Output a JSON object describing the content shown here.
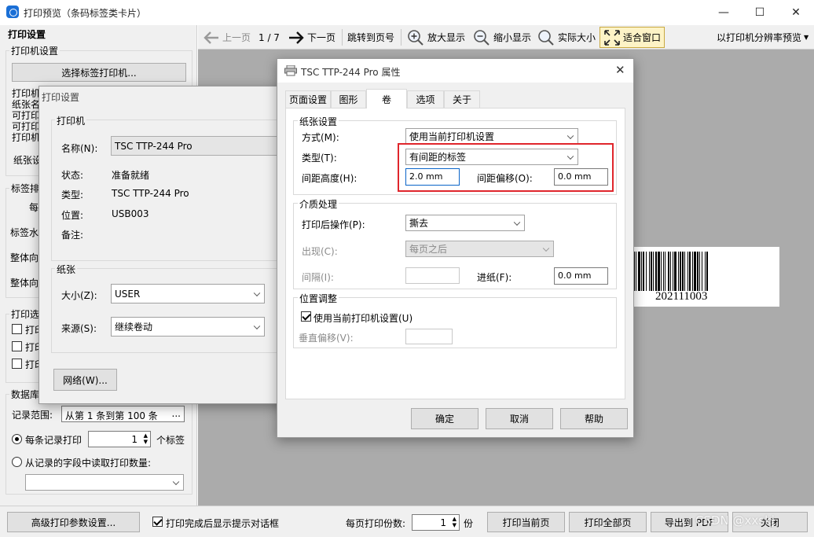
{
  "window": {
    "title": "打印预览（条码标签类卡片）",
    "minimize": "—",
    "maximize": "☐",
    "close": "✕"
  },
  "left_panel": {
    "header": "打印设置",
    "printer_group": {
      "title": "打印机设置",
      "select_button": "选择标签打印机...",
      "info_lines": [
        "打印机",
        "纸张名",
        "可打印",
        "可打印",
        "打印机"
      ],
      "paper_label": "纸张设"
    },
    "label_group": {
      "title": "标签排",
      "row1": "每",
      "watermark": "标签水",
      "orient1": "整体向",
      "orient2": "整体向"
    },
    "print_options": {
      "title": "打印选",
      "items": [
        "打印",
        "打印",
        "打印"
      ]
    },
    "database": {
      "title": "数据库",
      "range_label": "记录范围:",
      "range_value": "从第 1 条到第 100 条",
      "range_btn": "...",
      "per_record_label": "每条记录打印",
      "per_record_value": "1",
      "per_record_unit": "个标签",
      "from_field_label": "从记录的字段中读取打印数量:"
    }
  },
  "toolbar": {
    "prev": "上一页",
    "page": "1 / 7",
    "next": "下一页",
    "jump": "跳转到页号",
    "zoom_in": "放大显示",
    "zoom_out": "缩小显示",
    "actual": "实际大小",
    "fit": "适合窗口",
    "resolution": "以打印机分辨率预览"
  },
  "barcode": {
    "text": "202111003"
  },
  "bottom": {
    "advanced": "高级打印参数设置...",
    "show_dialog": "打印完成后显示提示对话框",
    "copies_label": "每页打印份数:",
    "copies_value": "1",
    "copies_unit": "份",
    "print_current": "打印当前页",
    "print_all": "打印全部页",
    "export_pdf": "导出到 PDF",
    "close": "关闭",
    "watermark": "CSDN @xxskj"
  },
  "print_settings_dialog": {
    "title": "打印设置",
    "printer_group": "打印机",
    "name_label": "名称(N):",
    "name_value": "TSC TTP-244 Pro",
    "status_label": "状态:",
    "status_value": "准备就绪",
    "type_label": "类型:",
    "type_value": "TSC TTP-244 Pro",
    "location_label": "位置:",
    "location_value": "USB003",
    "comment_label": "备注:",
    "paper_group": "纸张",
    "size_label": "大小(Z):",
    "size_value": "USER",
    "source_label": "来源(S):",
    "source_value": "继续卷动",
    "network_btn": "网络(W)..."
  },
  "properties_dialog": {
    "title": "TSC TTP-244 Pro 属性",
    "tabs": [
      "页面设置",
      "图形",
      "卷",
      "选项",
      "关于"
    ],
    "paper_group": "纸张设置",
    "method_label": "方式(M):",
    "method_value": "使用当前打印机设置",
    "type_label": "类型(T):",
    "type_value": "有间距的标签",
    "gap_height_label": "间距高度(H):",
    "gap_height_value": "2.0 mm",
    "gap_offset_label": "间距偏移(O):",
    "gap_offset_value": "0.0 mm",
    "media_group": "介质处理",
    "post_action_label": "打印后操作(P):",
    "post_action_value": "撕去",
    "occur_label": "出现(C):",
    "occur_value": "每页之后",
    "interval_label": "间隔(I):",
    "feed_label": "进纸(F):",
    "feed_value": "0.0 mm",
    "position_group": "位置调整",
    "use_current_label": "使用当前打印机设置(U)",
    "vertical_offset_label": "垂直偏移(V):",
    "ok": "确定",
    "cancel": "取消",
    "help": "帮助",
    "highlight_color": "#e0262c"
  }
}
